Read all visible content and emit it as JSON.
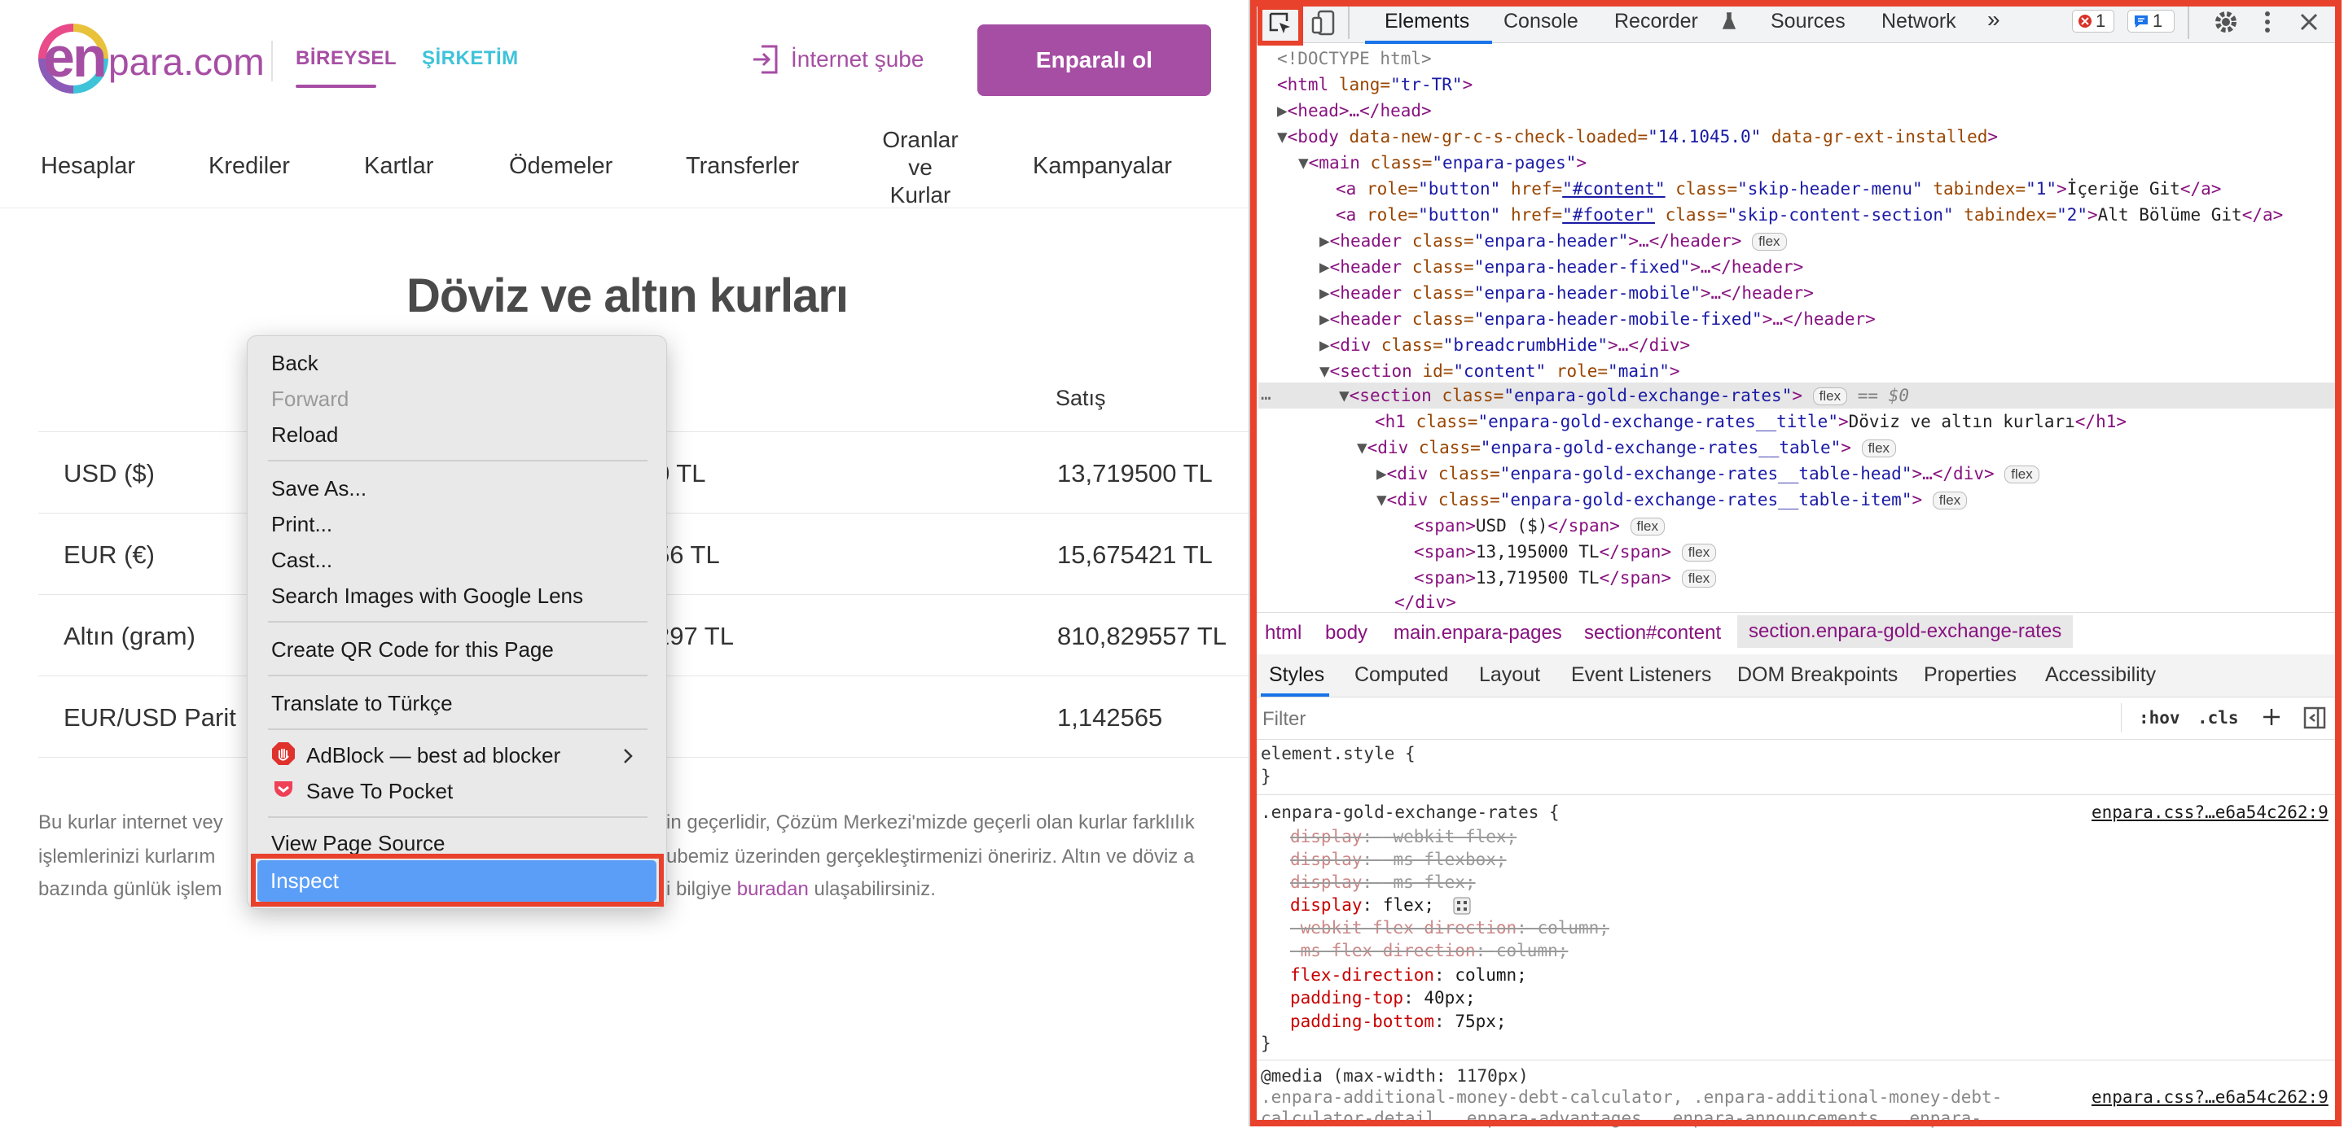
{
  "site": {
    "logo_en": "en",
    "logo_rest": "para.com",
    "segments": {
      "personal": "BİREYSEL",
      "business": "ŞİRKETİM"
    },
    "login_label": "İnternet şube",
    "cta_label": "Enparalı ol",
    "nav": [
      "Hesaplar",
      "Krediler",
      "Kartlar",
      "Ödemeler",
      "Transferler",
      "Oranlar ve Kurlar",
      "Kampanyalar"
    ],
    "nav_multi_lines": [
      "Oranlar",
      "ve",
      "Kurlar"
    ],
    "page_title": "Döviz ve altın kurları",
    "sell_header": "Satış",
    "rows": [
      {
        "name": "USD ($)",
        "buy_visible": "0 TL",
        "sell": "13,719500 TL"
      },
      {
        "name": "EUR (€)",
        "buy_visible": "56 TL",
        "sell": "15,675421 TL"
      },
      {
        "name": "Altın (gram)",
        "buy_visible": "297 TL",
        "sell": "810,829557 TL"
      },
      {
        "name": "EUR/USD Parit",
        "buy_visible": "",
        "sell": "1,142565"
      }
    ],
    "footnote": {
      "line1_left": "Bu kurlar internet vey",
      "line1_right": "in geçerlidir, Çözüm Merkezi'mizde geçerli olan kurlar farklılık",
      "line2_left": "işlemlerinizi kurlarım",
      "line2_right": "ubemiz üzerinden gerçekleştirmenizi öneririz. Altın ve döviz a",
      "line3_left": "bazında günlük işlem",
      "line3_mid": "i bilgiye",
      "line3_link": "buradan",
      "line3_end": "ulaşabilirsiniz."
    }
  },
  "context_menu": {
    "items": {
      "back": "Back",
      "forward": "Forward",
      "reload": "Reload",
      "save_as": "Save As...",
      "print": "Print...",
      "cast": "Cast...",
      "lens": "Search Images with Google Lens",
      "qr": "Create QR Code for this Page",
      "translate": "Translate to Türkçe",
      "adblock": "AdBlock — best ad blocker",
      "pocket": "Save To Pocket",
      "view_source": "View Page Source",
      "inspect": "Inspect"
    }
  },
  "devtools": {
    "tabs": [
      "Elements",
      "Console",
      "Recorder",
      "Sources",
      "Network",
      "»"
    ],
    "errors_count": "1",
    "messages_count": "1",
    "dom_lines": {
      "l1": "<!DOCTYPE html>",
      "l2_tag": "<html",
      "l2_attr": " lang=",
      "l2_val": "\"tr-TR\"",
      "l2_end": ">",
      "l3": "<head>…</head>",
      "l4a": "<body",
      "l4b": " data-new-gr-c-s-check-loaded=",
      "l4c": "\"14.1045.0\"",
      "l4d": " data-gr-ext-installed",
      "l4e": ">",
      "l5a": "<main",
      "l5b": " class=",
      "l5c": "\"enpara-pages\"",
      "l5d": ">",
      "l6a": "<a",
      "l6b": " role=",
      "l6c": "\"button\"",
      "l6d": " href=",
      "l6e": "\"#content\"",
      "l6f": " class=",
      "l6g": "\"skip-header-menu\"",
      "l6h": " tabindex=",
      "l6i": "\"1\"",
      "l6j": ">",
      "l6k": "İçeriğe Git",
      "l6l": "</a>",
      "l7e": "\"#footer\"",
      "l7g": "\"skip-content-section\"",
      "l7i": "\"2\"",
      "l7k": "Alt Bölüme Git",
      "l8c": "\"enpara-header\"",
      "l9c": "\"enpara-header-fixed\"",
      "l10c": "\"enpara-header-mobile\"",
      "l11c": "\"enpara-header-mobile-fixed\"",
      "l12c": "\"breadcrumbHide\"",
      "l13a": "<section",
      "l13b": " id=",
      "l13c": "\"content\"",
      "l13d": " role=",
      "l13e": "\"main\"",
      "l14c": "\"enpara-gold-exchange-rates\"",
      "l14eq": " == $0",
      "l15c": "\"enpara-gold-exchange-rates__title\"",
      "l15t": "Döviz ve altın kurları",
      "l16c": "\"enpara-gold-exchange-rates__table\"",
      "l17c": "\"enpara-gold-exchange-rates__table-head\"",
      "l18c": "\"enpara-gold-exchange-rates__table-item\"",
      "l19t": "USD ($)",
      "l20t": "13,195000 TL",
      "l21t": "13,719500 TL",
      "l22": "</div>",
      "pill_flex": "flex"
    },
    "breadcrumbs": [
      "html",
      "body",
      "main.enpara-pages",
      "section#content",
      "section.enpara-gold-exchange-rates"
    ],
    "subtabs": [
      "Styles",
      "Computed",
      "Layout",
      "Event Listeners",
      "DOM Breakpoints",
      "Properties",
      "Accessibility"
    ],
    "filter_placeholder": "Filter",
    "hov": ":hov",
    "cls": ".cls",
    "styles": {
      "element_style": "element.style {",
      "close": "}",
      "rule_selector": ".enpara-gold-exchange-rates {",
      "rule_source": "enpara.css?…e6a54c262:9",
      "decls": [
        {
          "prop": "display",
          "val": "-webkit-flex;",
          "struck": true
        },
        {
          "prop": "display",
          "val": "-ms-flexbox;",
          "struck": true
        },
        {
          "prop": "display",
          "val": "-ms-flex;",
          "struck": true
        },
        {
          "prop": "display",
          "val": "flex;",
          "struck": false
        },
        {
          "prop": "-webkit-flex-direction",
          "val": "column;",
          "struck": true
        },
        {
          "prop": "-ms-flex-direction",
          "val": "column;",
          "struck": true
        },
        {
          "prop": "flex-direction",
          "val": "column;",
          "struck": false
        },
        {
          "prop": "padding-top",
          "val": "40px;",
          "struck": false
        },
        {
          "prop": "padding-bottom",
          "val": "75px;",
          "struck": false
        }
      ],
      "media": "@media (max-width: 1170px)",
      "media_selector": ".enpara-additional-money-debt-calculator, .enpara-additional-money-debt-",
      "media_selector2": "calculator-detail, .enpara-advantages, .enpara-announcements, .enpara-",
      "media_source": "enpara.css?…e6a54c262:9"
    }
  },
  "colors": {
    "brand": "#a64ea4",
    "accent_secondary": "#3ec3d9",
    "highlight_box": "#e8412c",
    "menu_selection": "#5b9ef7"
  }
}
